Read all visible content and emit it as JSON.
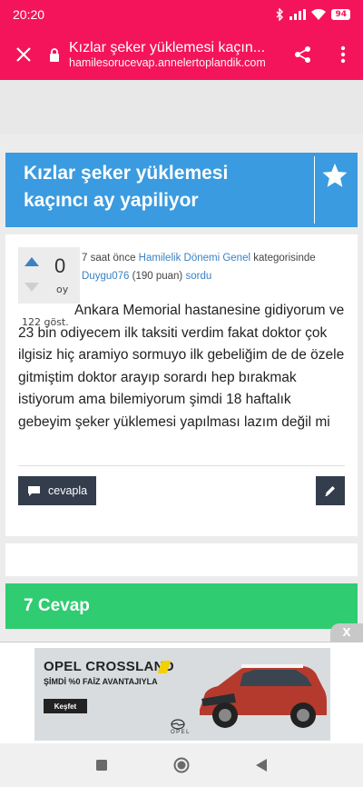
{
  "status_bar": {
    "time": "20:20",
    "battery": "94",
    "icons": [
      "bluetooth-icon",
      "signal-icon",
      "wifi-icon",
      "battery-icon"
    ]
  },
  "browser": {
    "page_title": "Kızlar şeker yüklemesi kaçın...",
    "url": "hamilesorucevap.annelertoplandik.com"
  },
  "question": {
    "title": "Kızlar şeker yüklemesi kaçıncı ay yapiliyor",
    "votes": "0",
    "votes_label": "oy",
    "views": "122 göst.",
    "meta": {
      "time": "7 saat önce",
      "category": "Hamilelik Dönemi Genel",
      "category_suffix": "kategorisinde",
      "author": "Duygu076",
      "points": "(190 puan)",
      "action": "sordu"
    },
    "body": "Ankara Memorial hastanesine gidiyorum ve 23 bin odiyecem ilk taksiti verdim fakat doktor çok ilgisiz hiç aramiyo sormuyo ilk gebeliğim de de özele gitmiştim doktor arayıp sorardı hep bırakmak istiyorum ama bilemiyorum şimdi 18 haftalık gebeyim şeker yüklemesi yapılması lazım değil mi",
    "answer_button": "cevapla"
  },
  "answers_header": "7 Cevap",
  "ad": {
    "close": "X",
    "title": "OPEL CROSSLAND",
    "subtitle": "ŞİMDİ %0 FAİZ AVANTAJIYLA",
    "button": "Keşfet",
    "brand": "OPEL"
  },
  "colors": {
    "accent": "#f4145b",
    "title_bg": "#3a9be0",
    "answers_bg": "#2fcc71",
    "dark_button": "#333d4c"
  }
}
